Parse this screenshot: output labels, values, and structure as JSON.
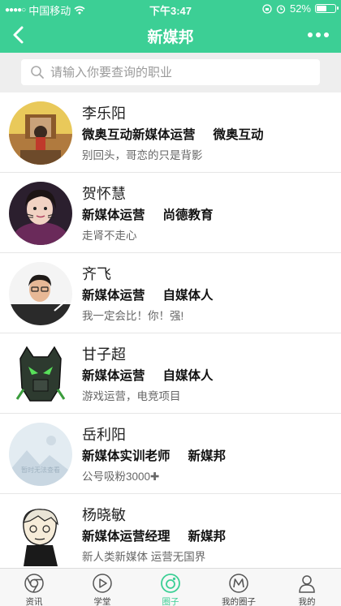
{
  "status_bar": {
    "carrier": "中国移动",
    "time": "下午3:47",
    "battery": "52%",
    "battery_level": 0.52
  },
  "header": {
    "title": "新媒邦",
    "back_icon": "chevron-left-icon",
    "more_icon": "more-dots-icon"
  },
  "search": {
    "placeholder": "请输入你要查询的职业",
    "value": ""
  },
  "people": [
    {
      "name": "李乐阳",
      "position": "微奥互动新媒体运营",
      "organization": "微奥互动",
      "motto": "别回头，哥恋的只是背影"
    },
    {
      "name": "贺怀慧",
      "position": "新媒体运营",
      "organization": "尚德教育",
      "motto": "走肾不走心"
    },
    {
      "name": "齐飞",
      "position": "新媒体运营",
      "organization": "自媒体人",
      "motto": "我一定会比！你！强!"
    },
    {
      "name": "甘子超",
      "position": "新媒体运营",
      "organization": "自媒体人",
      "motto": "游戏运营，电竞项目"
    },
    {
      "name": "岳利阳",
      "position": "新媒体实训老师",
      "organization": "新媒邦",
      "motto": "公号吸粉3000✚"
    },
    {
      "name": "杨晓敏",
      "position": "新媒体运营经理",
      "organization": "新媒邦",
      "motto": "新人类新媒体 运营无国界"
    }
  ],
  "avatar_placeholder_text": "暂时无法查看",
  "tabs": [
    {
      "label": "资讯",
      "icon": "chrome-icon"
    },
    {
      "label": "学堂",
      "icon": "play-icon"
    },
    {
      "label": "圈子",
      "icon": "circle-icon"
    },
    {
      "label": "我的圈子",
      "icon": "m-logo-icon"
    },
    {
      "label": "我的",
      "icon": "user-icon"
    }
  ],
  "active_tab": "圈子",
  "colors": {
    "accent": "#3ccf95"
  }
}
